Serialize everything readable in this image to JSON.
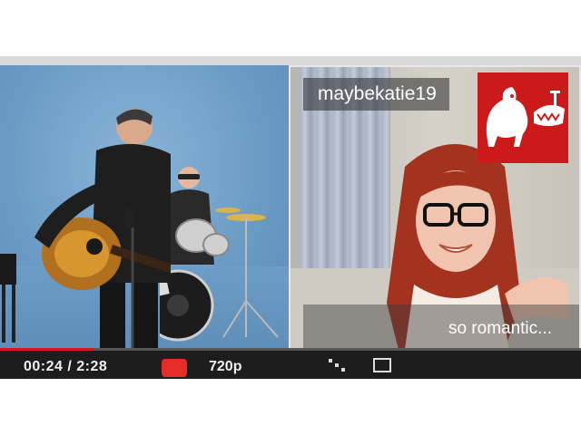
{
  "player": {
    "current_time": "00:24",
    "separator": "/",
    "duration": "2:28",
    "quality": "720p",
    "progress_fraction": 0.162
  },
  "webcam": {
    "username": "maybekatie19",
    "caption": "so romantic..."
  },
  "colors": {
    "backdrop_blue": "#6f9fc8",
    "control_bar": "#1d1d1d",
    "progress_red": "#cc181e",
    "logo_red": "#cc1a1a"
  },
  "icons": [
    "rooster-teeth-logo-icon",
    "youtube-logo-icon",
    "settings-icon",
    "fullscreen-icon"
  ]
}
